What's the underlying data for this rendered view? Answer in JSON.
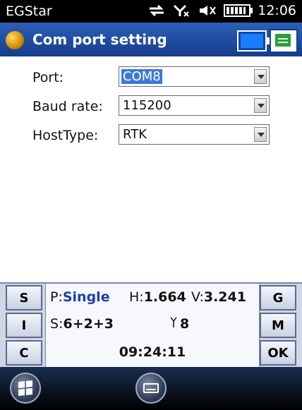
{
  "status_bar": {
    "app_name": "EGStar",
    "time": "12:06",
    "icons": [
      "sync-icon",
      "no-signal-icon",
      "volume-muted-icon",
      "battery-icon"
    ]
  },
  "title_bar": {
    "title": "Com port setting",
    "logo_icon": "app-logo-icon",
    "buttons": [
      "battery-status-button",
      "notes-button"
    ]
  },
  "form": {
    "port": {
      "label": "Port:",
      "value": "COM8"
    },
    "baud_rate": {
      "label": "Baud rate:",
      "value": "115200"
    },
    "host_type": {
      "label": "HostType:",
      "value": "RTK"
    }
  },
  "panel": {
    "left_buttons": [
      "S",
      "I",
      "C"
    ],
    "right_buttons": [
      "G",
      "M",
      "OK"
    ],
    "position_label": "P:",
    "position_value": "Single",
    "h_label": "H:",
    "h_value": "1.664",
    "v_label": "V:",
    "v_value": "3.241",
    "s_label": "S:",
    "s_value": "6+2+3",
    "antenna_value": "8",
    "time": "09:24:11"
  },
  "taskbar": {
    "start_icon": "windows-start-icon",
    "keyboard_icon": "keyboard-icon"
  }
}
